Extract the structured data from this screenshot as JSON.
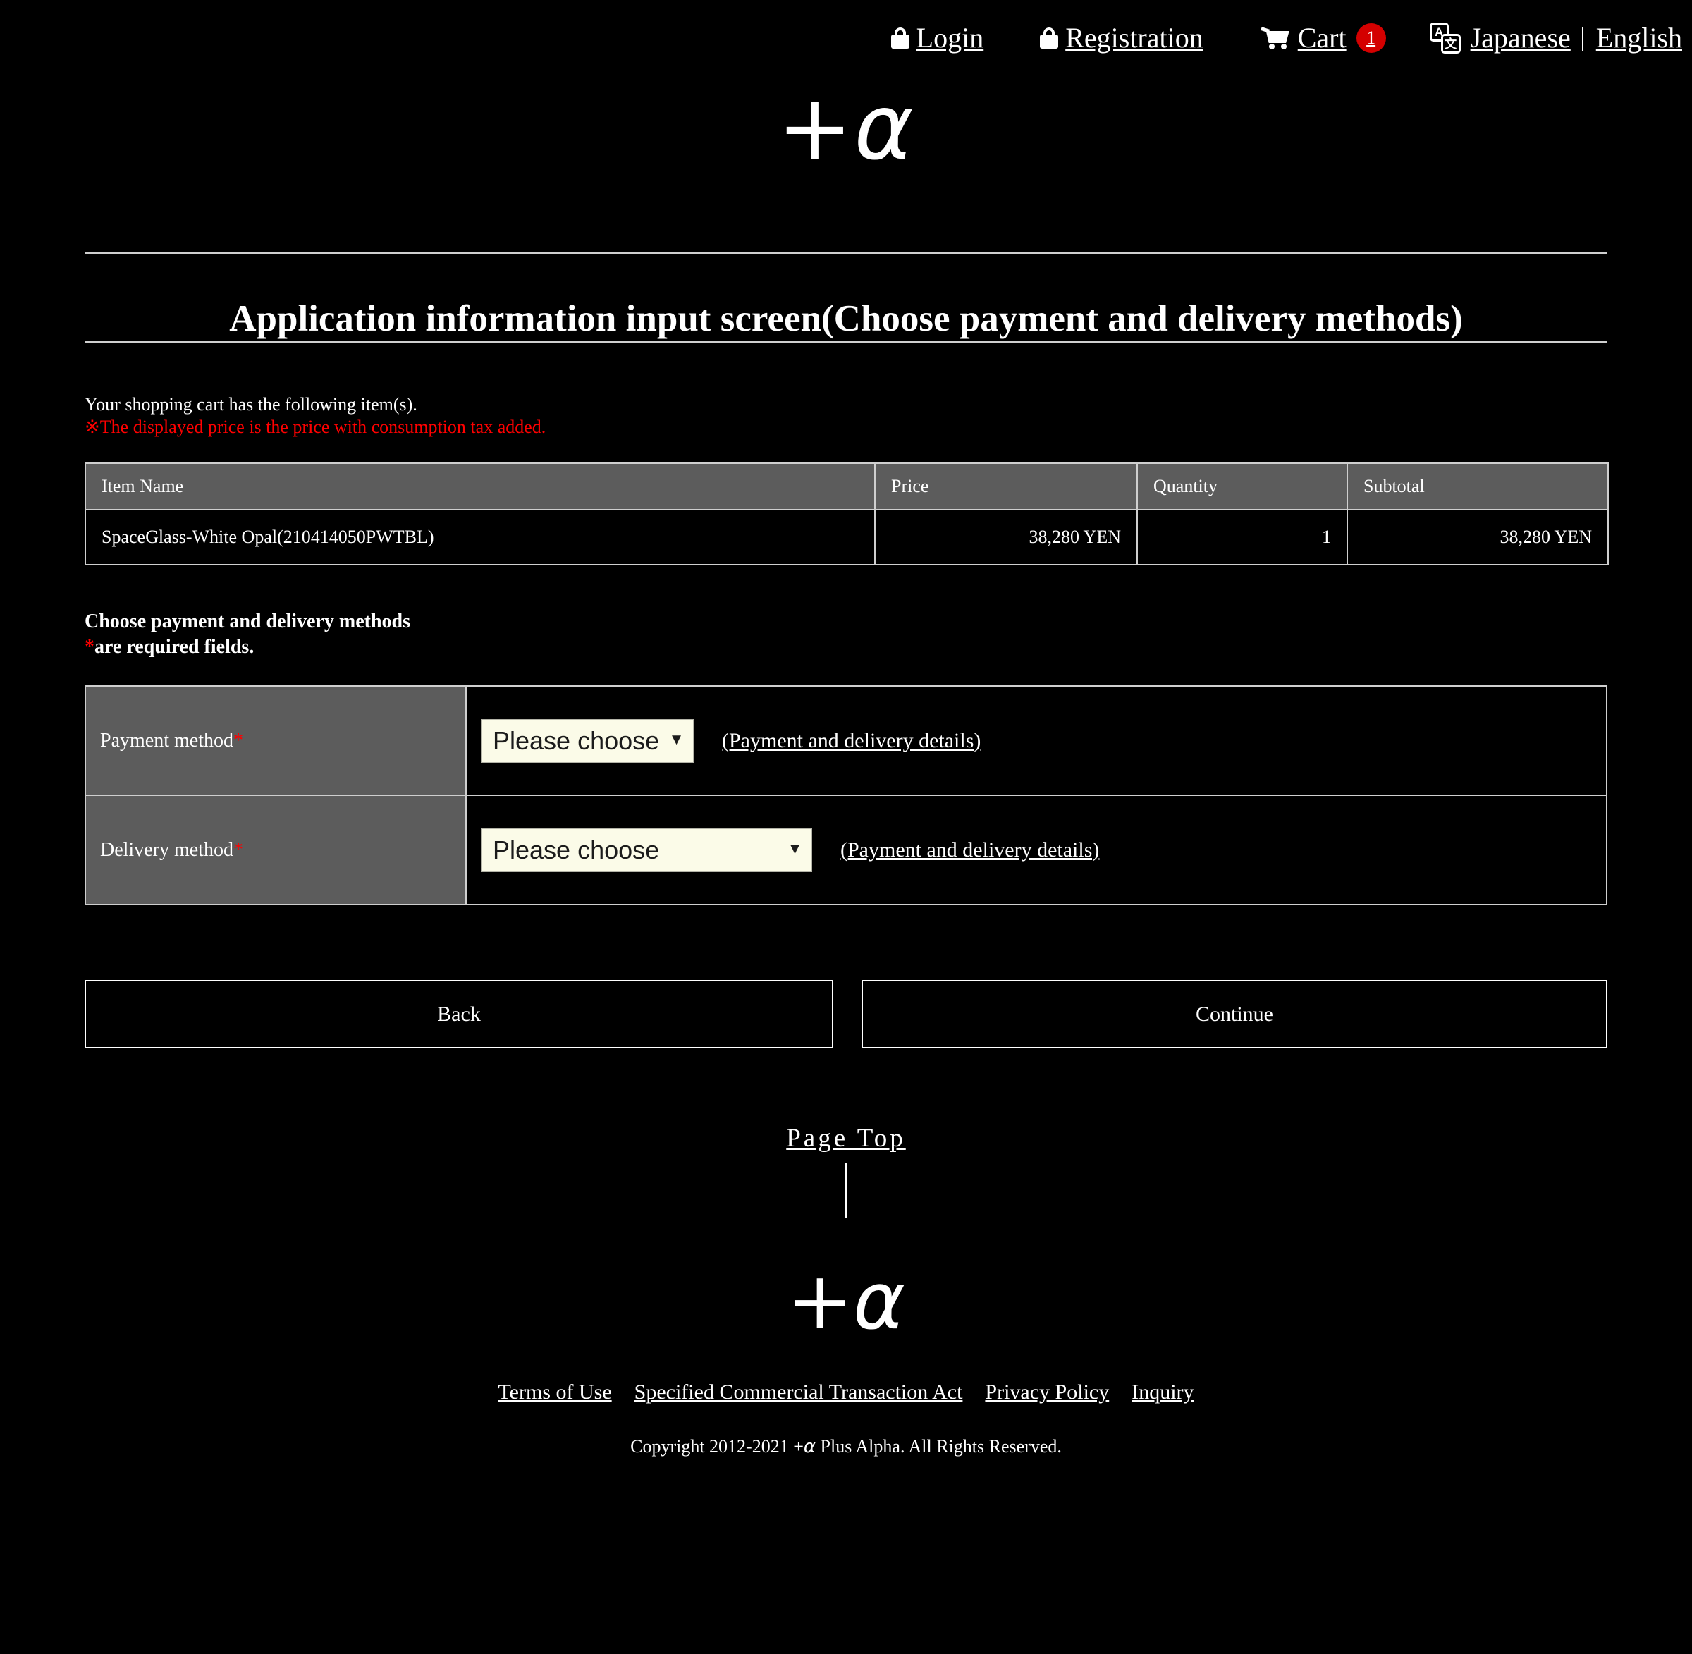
{
  "topbar": {
    "login": "Login",
    "registration": "Registration",
    "cart": "Cart",
    "cart_count": "1",
    "lang_icon_a": "A",
    "lang_icon_b": "文",
    "lang_japanese": "Japanese",
    "lang_english": "English"
  },
  "brand": {
    "plus": "+",
    "alpha": "α"
  },
  "page": {
    "title": "Application information input screen(Choose payment and delivery methods)"
  },
  "notice": {
    "line1": "Your shopping cart has the following item(s).",
    "line2": "※The displayed price is the price with consumption tax added."
  },
  "cart_table": {
    "headers": {
      "name": "Item Name",
      "price": "Price",
      "quantity": "Quantity",
      "subtotal": "Subtotal"
    },
    "rows": [
      {
        "name": "SpaceGlass-White Opal(210414050PWTBL)",
        "price": "38,280 YEN",
        "quantity": "1",
        "subtotal": "38,280 YEN"
      }
    ]
  },
  "section": {
    "heading": "Choose payment and delivery methods",
    "required_marker": "*",
    "required_note": "are required fields."
  },
  "form": {
    "payment": {
      "label": "Payment method",
      "required_marker": "*",
      "select_value": "Please choose",
      "select_options": [
        "Please choose"
      ],
      "detail_link": "(Payment and delivery details)"
    },
    "delivery": {
      "label": "Delivery method",
      "required_marker": "*",
      "select_value": "Please choose",
      "select_options": [
        "Please choose"
      ],
      "detail_link": "(Payment and delivery details)"
    }
  },
  "buttons": {
    "back": "Back",
    "continue": "Continue"
  },
  "page_top": {
    "label": "Page Top"
  },
  "footer": {
    "links": [
      "Terms of Use",
      "Specified Commercial Transaction Act",
      "Privacy Policy",
      "Inquiry"
    ],
    "copyright_prefix": "Copyright 2012-2021 +",
    "copyright_alpha": "α",
    "copyright_suffix": " Plus Alpha. All Rights Reserved."
  },
  "colors": {
    "background": "#000000",
    "accent_red": "#d40000",
    "required_red": "#ff0000",
    "header_gray": "#5c5c5c",
    "border_gray": "#cfcfcf",
    "select_bg": "#fbfbe8"
  }
}
